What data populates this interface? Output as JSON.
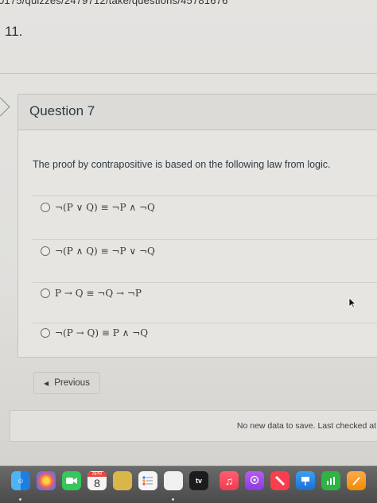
{
  "browser": {
    "url_fragment": "0175/quizzes/2479712/take/questions/45781676"
  },
  "previous_question": {
    "number": "11."
  },
  "question": {
    "title": "Question 7",
    "prompt": "The proof by contrapositive is based on the following law from logic.",
    "answers": [
      {
        "label": "¬(P ∨ Q) ≡ ¬P ∧ ¬Q"
      },
      {
        "label": "¬(P ∧ Q) ≡ ¬P ∨ ¬Q"
      },
      {
        "label": "P → Q ≡ ¬Q → ¬P"
      },
      {
        "label": "¬(P → Q) ≡ P ∧ ¬Q"
      }
    ]
  },
  "nav": {
    "previous_label": "Previous"
  },
  "status": {
    "text": "No new data to save. Last checked at"
  },
  "dock": {
    "calendar_month": "APR",
    "calendar_day": "8",
    "tv_label": "tv",
    "icons": [
      "finder-icon",
      "photos-icon",
      "facetime-icon",
      "calendar-icon",
      "notes-icon",
      "reminders-icon",
      "blank-app-icon",
      "apple-tv-icon",
      "music-icon",
      "podcasts-icon",
      "news-icon",
      "keynote-icon",
      "numbers-icon",
      "pages-icon"
    ]
  }
}
